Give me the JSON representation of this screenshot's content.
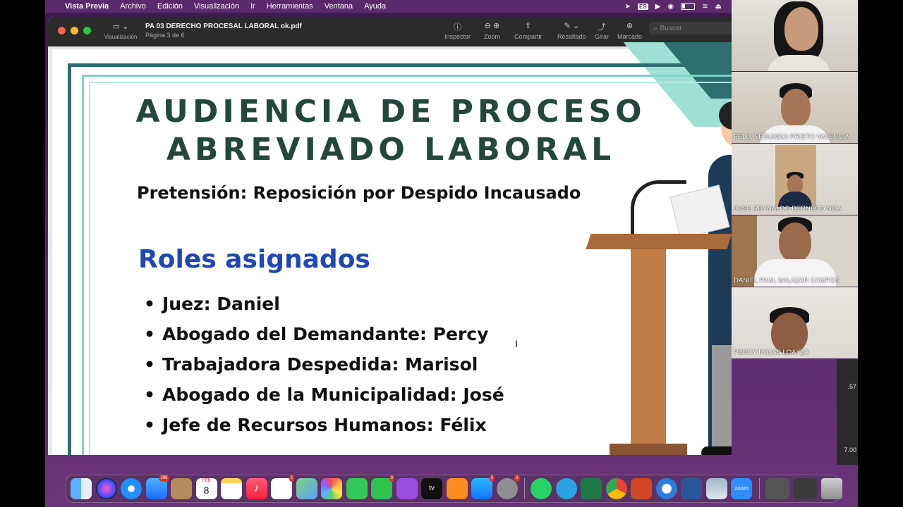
{
  "menubar": {
    "apple": "",
    "items": [
      "Vista Previa",
      "Archivo",
      "Edición",
      "Visualización",
      "Ir",
      "Herramientas",
      "Ventana",
      "Ayuda"
    ],
    "input_source": "ES"
  },
  "window": {
    "sidebar_label": "Visualización",
    "title": "PA 03 DERECHO PROCESAL LABORAL ok.pdf",
    "subtitle": "Página 3 de 6",
    "toolbar": {
      "inspector": "Inspector",
      "zoom": "Zoom",
      "share": "Compartir",
      "highlight": "Resaltado",
      "rotate": "Girar",
      "markup": "Marcado"
    },
    "search_placeholder": "Buscar"
  },
  "slide": {
    "title_line1": "AUDIENCIA DE PROCESO",
    "title_line2": "ABREVIADO LABORAL",
    "subtitle": "Pretensión: Reposición por Despido Incausado",
    "roles_heading": "Roles asignados",
    "roles": [
      "Juez: Daniel",
      "Abogado del Demandante: Percy",
      "Trabajadora Despedida: Marisol",
      "Abogado de la Municipalidad: José",
      "Jefe de Recursos Humanos: Félix"
    ]
  },
  "participants": [
    {
      "name": ""
    },
    {
      "name": "FELIX SEGUNDO PRIETO VALENCIA"
    },
    {
      "name": "JOSE REYNALDO BERNEDO NOA"
    },
    {
      "name": "DANIEL PAUL SALAZAR CAMPOS"
    },
    {
      "name": "PERCY ROJAS LOAYZA"
    }
  ],
  "side_values": [
    ".57",
    "7.00"
  ],
  "dock": {
    "badges": {
      "mail": "296",
      "reminders": "2",
      "facetime": "3",
      "appstore": "6",
      "settings": "2"
    },
    "calendar_month": "FEB",
    "calendar_day": "8",
    "apps": [
      "finder-icon",
      "siri-icon",
      "safari-icon",
      "mail-icon",
      "contacts-icon",
      "calendar-icon",
      "notes-icon",
      "music-icon",
      "reminders-icon",
      "maps-icon",
      "photos-icon",
      "messages-icon",
      "facetime-icon",
      "podcasts-icon",
      "tv-icon",
      "books-icon",
      "appstore-icon",
      "settings-icon",
      "whatsapp-icon",
      "telegram-icon",
      "excel-icon",
      "chrome-icon",
      "powerpoint-icon",
      "quicktime-icon",
      "word-icon",
      "preview-icon",
      "zoom-icon",
      "downloads-icon",
      "screenshots-icon",
      "trash-icon"
    ],
    "zoom_label": "zoom",
    "tv_label": "tv"
  }
}
